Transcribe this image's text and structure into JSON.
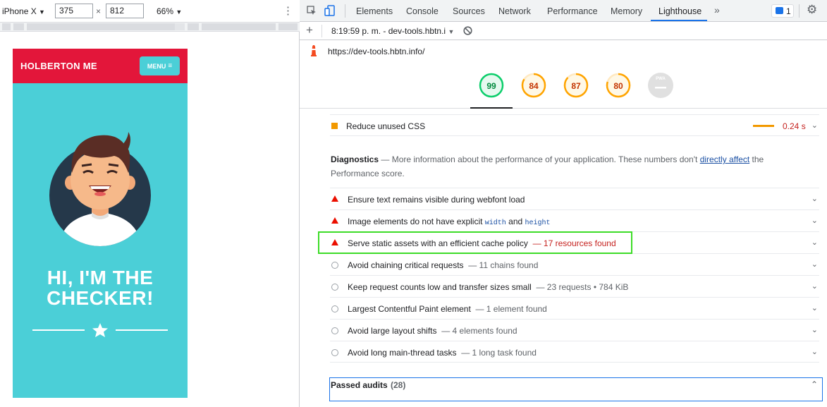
{
  "device_toolbar": {
    "device": "iPhone X",
    "width": "375",
    "times": "×",
    "height": "812",
    "zoom": "66%"
  },
  "phone": {
    "brand": "HOLBERTON ME",
    "menu_label": "MENU",
    "hero_title_line1": "HI, I'M THE",
    "hero_title_line2": "CHECKER!",
    "colors": {
      "nav": "#e3163a",
      "hero": "#4bcfd7"
    }
  },
  "devtools": {
    "tabs": [
      "Elements",
      "Console",
      "Sources",
      "Network",
      "Performance",
      "Memory",
      "Lighthouse"
    ],
    "active_tab": "Lighthouse",
    "more_tabs": "»",
    "issues_count": "1",
    "report_label": "8:19:59 p. m. - dev-tools.hbtn.i",
    "url": "https://dev-tools.hbtn.info/",
    "gauges": [
      {
        "score": "99",
        "color": "#0cce6b"
      },
      {
        "score": "84",
        "color": "#ffa400"
      },
      {
        "score": "87",
        "color": "#ffa400"
      },
      {
        "score": "80",
        "color": "#ffa400"
      },
      {
        "score": "PWA",
        "color": "#9aa0a6"
      }
    ],
    "opportunity": {
      "title": "Reduce unused CSS",
      "value": "0.24 s"
    },
    "diagnostics": {
      "heading": "Diagnostics",
      "dash": "—",
      "text": "More information about the performance of your application. These numbers don't",
      "link": "directly affect",
      "text_after": "the",
      "line2": "Performance score."
    },
    "audits": [
      {
        "title": "Ensure text remains visible during webfont load",
        "detail": "",
        "kind": "fail"
      },
      {
        "title": "Image elements do not have explicit",
        "code1": "width",
        "and": "and",
        "code2": "height",
        "detail": "",
        "kind": "fail"
      },
      {
        "title": "Serve static assets with an efficient cache policy",
        "detail": "— 17 resources found",
        "kind": "fail"
      },
      {
        "title": "Avoid chaining critical requests",
        "detail": "— 11 chains found",
        "kind": "info"
      },
      {
        "title": "Keep request counts low and transfer sizes small",
        "detail": "— 23 requests • 784 KiB",
        "kind": "info"
      },
      {
        "title": "Largest Contentful Paint element",
        "detail": "— 1 element found",
        "kind": "info"
      },
      {
        "title": "Avoid large layout shifts",
        "detail": "— 4 elements found",
        "kind": "info"
      },
      {
        "title": "Avoid long main-thread tasks",
        "detail": "— 1 long task found",
        "kind": "info"
      }
    ],
    "passed": {
      "label": "Passed audits",
      "count": "(28)"
    }
  }
}
